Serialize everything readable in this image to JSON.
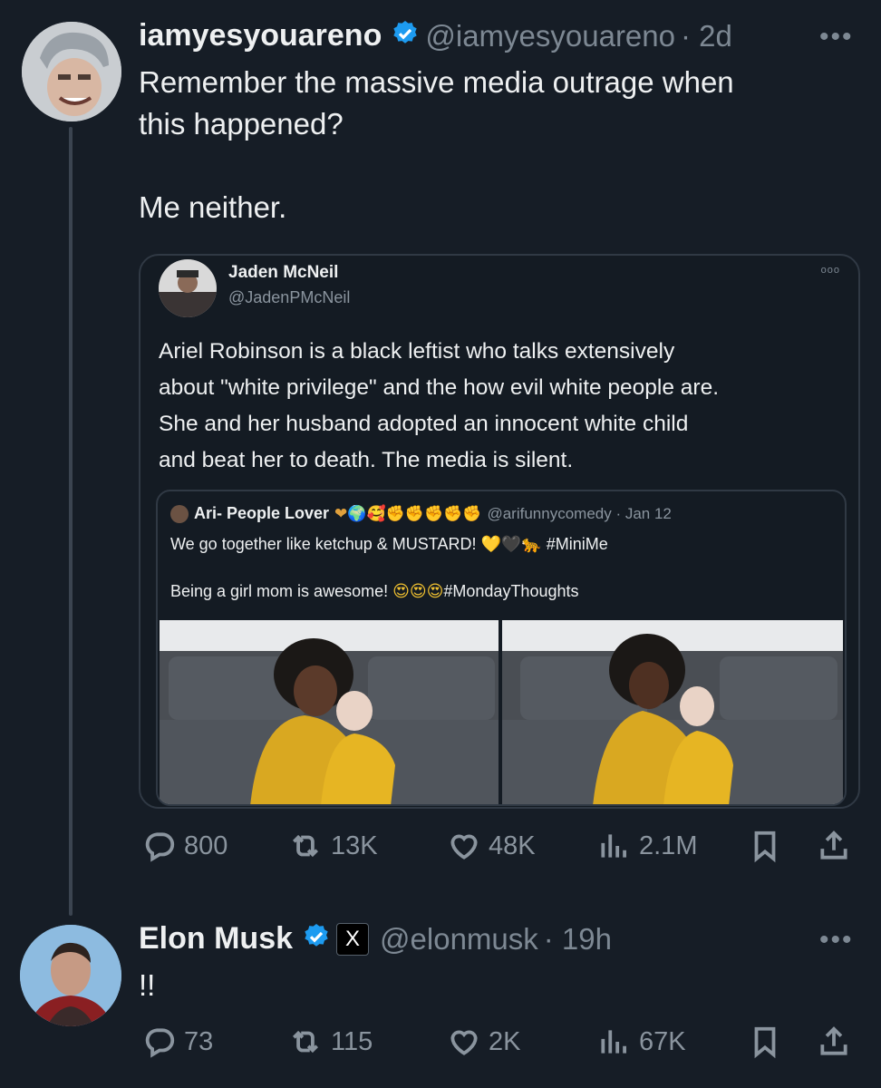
{
  "tweet1": {
    "name": "iamyesyouareno",
    "handle": "@iamyesyouareno",
    "time": "· 2d",
    "text": "Remember the massive media outrage when\nthis happened?\n\nMe neither.",
    "stats": {
      "replies": "800",
      "retweets": "13K",
      "likes": "48K",
      "views": "2.1M"
    }
  },
  "quoted": {
    "name": "Jaden McNeil",
    "handle": "@JadenPMcNeil",
    "text": "Ariel Robinson is a black leftist who talks extensively\nabout \"white privilege\" and the how evil white people are.\nShe and her husband adopted an innocent white child\nand beat her to death. The media is silent.",
    "nested": {
      "name": "Ari- People Lover",
      "name_emoji": "❤🌍🥰✊✊✊✊✊",
      "handle": "@arifunnycomedy · Jan 12",
      "line1": "We go together like ketchup & MUSTARD! ",
      "line1_emoji": "💛🖤🐆",
      "line1_tag": "#MiniMe",
      "line2": "Being a girl mom is awesome! ",
      "line2_emoji": "😍😍😍",
      "line2_tag": "#MondayThoughts"
    }
  },
  "tweet2": {
    "name": "Elon Musk",
    "handle": "@elonmusk",
    "time": "· 19h",
    "x_badge": "X",
    "text": "!!",
    "stats": {
      "replies": "73",
      "retweets": "115",
      "likes": "2K",
      "views": "67K"
    }
  },
  "more_label": "•••",
  "colors": {
    "background": "#161d26",
    "verified": "#1d9bf0",
    "muted": "#7d8893",
    "border": "#303944"
  },
  "icons": [
    "reply-icon",
    "retweet-icon",
    "like-icon",
    "views-icon",
    "bookmark-icon",
    "share-icon",
    "verified-badge-icon"
  ]
}
